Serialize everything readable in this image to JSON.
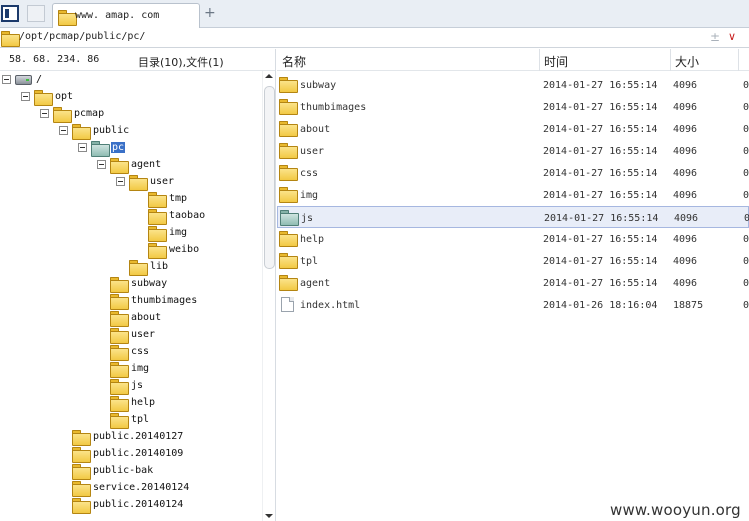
{
  "tab": {
    "title": "www. amap. com"
  },
  "address": {
    "path": "/opt/pcmap/public/pc/",
    "star_glyph": "±",
    "drop_glyph": "∨"
  },
  "left": {
    "server": "58. 68. 234. 86",
    "dir_count": "目录(10),文件(1)"
  },
  "tree": [
    {
      "label": "/",
      "icon": "drive-icon",
      "toggle": true
    },
    {
      "label": "opt",
      "icon": "folder-icon",
      "toggle": true
    },
    {
      "label": "pcmap",
      "icon": "folder-icon",
      "toggle": true
    },
    {
      "label": "public",
      "icon": "folder-icon",
      "toggle": true
    },
    {
      "label": "pc",
      "icon": "folder-open-icon",
      "toggle": true,
      "selected": true
    },
    {
      "label": "agent",
      "icon": "folder-icon",
      "toggle": true
    },
    {
      "label": "user",
      "icon": "folder-icon",
      "toggle": true
    },
    {
      "label": "tmp",
      "icon": "folder-icon"
    },
    {
      "label": "taobao",
      "icon": "folder-icon"
    },
    {
      "label": "img",
      "icon": "folder-icon"
    },
    {
      "label": "weibo",
      "icon": "folder-icon"
    },
    {
      "label": "lib",
      "icon": "folder-icon"
    },
    {
      "label": "subway",
      "icon": "folder-icon"
    },
    {
      "label": "thumbimages",
      "icon": "folder-icon"
    },
    {
      "label": "about",
      "icon": "folder-icon"
    },
    {
      "label": "user",
      "icon": "folder-icon"
    },
    {
      "label": "css",
      "icon": "folder-icon"
    },
    {
      "label": "img",
      "icon": "folder-icon"
    },
    {
      "label": "js",
      "icon": "folder-icon"
    },
    {
      "label": "help",
      "icon": "folder-icon"
    },
    {
      "label": "tpl",
      "icon": "folder-icon"
    },
    {
      "label": "public.20140127",
      "icon": "folder-icon"
    },
    {
      "label": "public.20140109",
      "icon": "folder-icon"
    },
    {
      "label": "public-bak",
      "icon": "folder-icon"
    },
    {
      "label": "service.20140124",
      "icon": "folder-icon"
    },
    {
      "label": "public.20140124",
      "icon": "folder-icon"
    }
  ],
  "table": {
    "headers": {
      "name": "名称",
      "time": "时间",
      "size": "大小"
    },
    "rows": [
      {
        "name": "subway",
        "time": "2014-01-27 16:55:14",
        "size": "4096",
        "extra": "0",
        "type": "folder"
      },
      {
        "name": "thumbimages",
        "time": "2014-01-27 16:55:14",
        "size": "4096",
        "extra": "0",
        "type": "folder"
      },
      {
        "name": "about",
        "time": "2014-01-27 16:55:14",
        "size": "4096",
        "extra": "0",
        "type": "folder"
      },
      {
        "name": "user",
        "time": "2014-01-27 16:55:14",
        "size": "4096",
        "extra": "0",
        "type": "folder"
      },
      {
        "name": "css",
        "time": "2014-01-27 16:55:14",
        "size": "4096",
        "extra": "0",
        "type": "folder"
      },
      {
        "name": "img",
        "time": "2014-01-27 16:55:14",
        "size": "4096",
        "extra": "0",
        "type": "folder"
      },
      {
        "name": "js",
        "time": "2014-01-27 16:55:14",
        "size": "4096",
        "extra": "0",
        "type": "folder",
        "highlighted": true
      },
      {
        "name": "help",
        "time": "2014-01-27 16:55:14",
        "size": "4096",
        "extra": "0",
        "type": "folder"
      },
      {
        "name": "tpl",
        "time": "2014-01-27 16:55:14",
        "size": "4096",
        "extra": "0",
        "type": "folder"
      },
      {
        "name": "agent",
        "time": "2014-01-27 16:55:14",
        "size": "4096",
        "extra": "0",
        "type": "folder"
      },
      {
        "name": "index.html",
        "time": "2014-01-26 18:16:04",
        "size": "18875",
        "extra": "0",
        "type": "file"
      }
    ]
  },
  "watermark": "www.wooyun.org"
}
